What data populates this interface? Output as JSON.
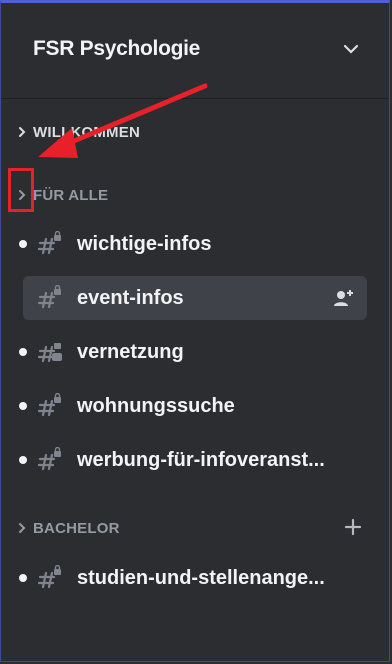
{
  "server": {
    "name": "FSR Psychologie"
  },
  "categories": [
    {
      "label": "WILLKOMMEN"
    },
    {
      "label": "FÜR ALLE"
    },
    {
      "label": "BACHELOR"
    }
  ],
  "channels": [
    {
      "name": "wichtige-infos",
      "unread": true
    },
    {
      "name": "event-infos",
      "active": true
    },
    {
      "name": "vernetzung",
      "unread": true
    },
    {
      "name": "wohnungssuche",
      "unread": true
    },
    {
      "name": "werbung-für-infoveranst...",
      "unread": true
    },
    {
      "name": "studien-und-stellenange...",
      "unread": true
    }
  ],
  "colors": {
    "background": "#2b2d31",
    "active_channel": "#404249",
    "annotation": "#e8202a"
  },
  "icons": {
    "server_menu": "chevron-down-icon",
    "category": "chevron-right-icon",
    "channel": "locked-hash-icon",
    "invite": "add-member-icon",
    "create_channel": "plus-icon"
  }
}
